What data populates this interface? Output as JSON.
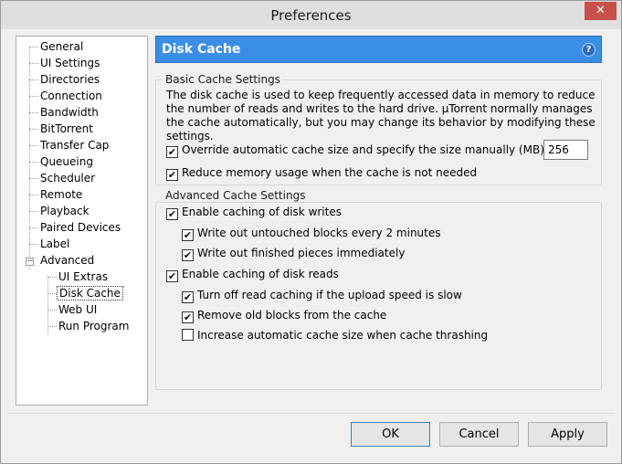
{
  "window": {
    "title": "Preferences",
    "close_glyph": "✕"
  },
  "tree": {
    "items": [
      {
        "label": "General"
      },
      {
        "label": "UI Settings"
      },
      {
        "label": "Directories"
      },
      {
        "label": "Connection"
      },
      {
        "label": "Bandwidth"
      },
      {
        "label": "BitTorrent"
      },
      {
        "label": "Transfer Cap"
      },
      {
        "label": "Queueing"
      },
      {
        "label": "Scheduler"
      },
      {
        "label": "Remote"
      },
      {
        "label": "Playback"
      },
      {
        "label": "Paired Devices"
      },
      {
        "label": "Label"
      },
      {
        "label": "Advanced",
        "expanded": true,
        "expander_glyph": "−"
      }
    ],
    "subitems": [
      {
        "label": "UI Extras"
      },
      {
        "label": "Disk Cache",
        "selected": true
      },
      {
        "label": "Web UI"
      },
      {
        "label": "Run Program"
      }
    ]
  },
  "header": {
    "title": "Disk Cache",
    "help_icon": "?",
    "color": "#3a8ee6"
  },
  "basic": {
    "title": "Basic Cache Settings",
    "description": "The disk cache is used to keep frequently accessed data in memory to reduce the number of reads and writes to the hard drive. µTorrent normally manages the cache automatically, but you may change its behavior by modifying these settings.",
    "override_label": "Override automatic cache size and specify the size manually (MB):",
    "override_checked": true,
    "size_value": "256",
    "reduce_label": "Reduce memory usage when the cache is not needed",
    "reduce_checked": true
  },
  "advanced": {
    "title": "Advanced Cache Settings",
    "options": [
      {
        "label": "Enable caching of disk writes",
        "checked": true
      },
      {
        "label": "Write out untouched blocks every 2 minutes",
        "checked": true
      },
      {
        "label": "Write out finished pieces immediately",
        "checked": true
      },
      {
        "label": "Enable caching of disk reads",
        "checked": true
      },
      {
        "label": "Turn off read caching if the upload speed is slow",
        "checked": true
      },
      {
        "label": "Remove old blocks from the cache",
        "checked": true
      },
      {
        "label": "Increase automatic cache size when cache thrashing",
        "checked": false
      }
    ]
  },
  "buttons": {
    "ok": "OK",
    "cancel": "Cancel",
    "apply": "Apply"
  },
  "check_glyph": "✔"
}
